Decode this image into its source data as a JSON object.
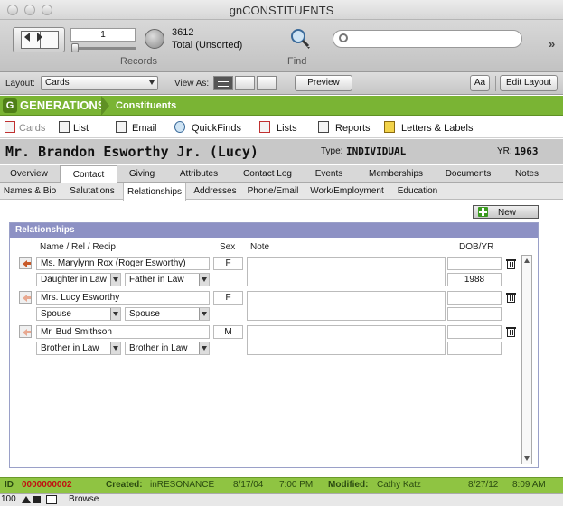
{
  "window": {
    "title": "gnCONSTITUENTS"
  },
  "toolbar": {
    "record_number": "1",
    "record_count": "3612",
    "record_total": "Total (Unsorted)",
    "records_label": "Records",
    "find_label": "Find",
    "search_placeholder": ""
  },
  "layoutbar": {
    "layout_label": "Layout:",
    "layout_value": "Cards",
    "view_as_label": "View As:",
    "preview_label": "Preview",
    "aa_label": "Aa",
    "edit_layout_label": "Edit Layout"
  },
  "header": {
    "brand": "GENERATIONS",
    "brand_icon": "G",
    "section": "Constituents"
  },
  "nav": [
    {
      "label": "Cards"
    },
    {
      "label": "List"
    },
    {
      "label": "Email"
    },
    {
      "label": "QuickFinds"
    },
    {
      "label": "Lists"
    },
    {
      "label": "Reports"
    },
    {
      "label": "Letters & Labels"
    }
  ],
  "record": {
    "name": "Mr. Brandon Esworthy Jr. (Lucy)",
    "type_label": "Type:",
    "type_value": "INDIVIDUAL",
    "yr_label": "YR:",
    "yr_value": "1963"
  },
  "tabs_main": [
    "Overview",
    "Contact",
    "Giving",
    "Attributes",
    "Contact Log",
    "Events",
    "Memberships",
    "Documents",
    "Notes"
  ],
  "tabs_sub": [
    "Names & Bio",
    "Salutations",
    "Relationships",
    "Addresses",
    "Phone/Email",
    "Work/Employment",
    "Education"
  ],
  "relationships": {
    "new_label": "New",
    "title": "Relationships",
    "col_name": "Name / Rel / Recip",
    "col_sex": "Sex",
    "col_note": "Note",
    "col_dob": "DOB/YR",
    "rows": [
      {
        "name": "Ms. Marylynn Rox (Roger Esworthy)",
        "rel": "Daughter in Law",
        "recip": "Father in Law",
        "sex": "F",
        "dob": "",
        "yr": "1988"
      },
      {
        "name": "Mrs. Lucy Esworthy",
        "rel": "Spouse",
        "recip": "Spouse",
        "sex": "F",
        "dob": "",
        "yr": ""
      },
      {
        "name": "Mr. Bud Smithson",
        "rel": "Brother in Law",
        "recip": "Brother in Law",
        "sex": "M",
        "dob": "",
        "yr": ""
      }
    ]
  },
  "status": {
    "id_label": "ID",
    "id_value": "0000000002",
    "created_label": "Created:",
    "created_by": "inRESONANCE",
    "created_date": "8/17/04",
    "created_time": "7:00 PM",
    "modified_label": "Modified:",
    "modified_by": "Cathy Katz",
    "modified_date": "8/27/12",
    "modified_time": "8:09 AM"
  },
  "bottom": {
    "zoom": "100",
    "mode": "Browse"
  }
}
